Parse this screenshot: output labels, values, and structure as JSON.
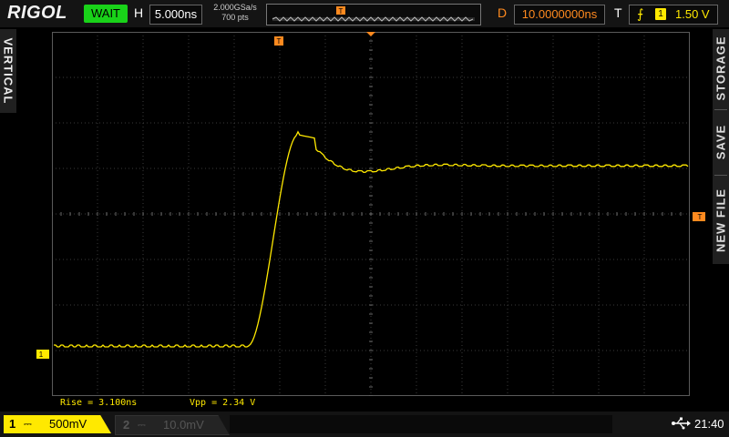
{
  "brand": "RIGOL",
  "status": "WAIT",
  "horizontal": {
    "label": "H",
    "timebase": "5.000ns",
    "sample_rate": "2.000GSa/s",
    "memory_depth": "700 pts",
    "memory_marker": "T"
  },
  "delay": {
    "label": "D",
    "value": "10.0000000ns"
  },
  "trigger": {
    "label": "T",
    "edge_icon": "rising-edge-icon",
    "source": "1",
    "level": "1.50 V",
    "marker": "T",
    "color": "#ff8a1f"
  },
  "side_tabs": {
    "left": "VERTICAL",
    "right": [
      "STORAGE",
      "SAVE",
      "NEW FILE"
    ]
  },
  "measurements": {
    "rise": "Rise = 3.100ns",
    "vpp": "Vpp = 2.34 V"
  },
  "channels": [
    {
      "number": "1",
      "coupling": "⎓",
      "scale": "500mV",
      "color": "#ffe900",
      "active": true
    },
    {
      "number": "2",
      "coupling": "⎓",
      "scale": "10.0mV",
      "color": "#555555",
      "active": false
    }
  ],
  "channel_marker": "1",
  "clock": "21:40",
  "usb_icon": "usb-icon",
  "trace_color": "#ffe900"
}
